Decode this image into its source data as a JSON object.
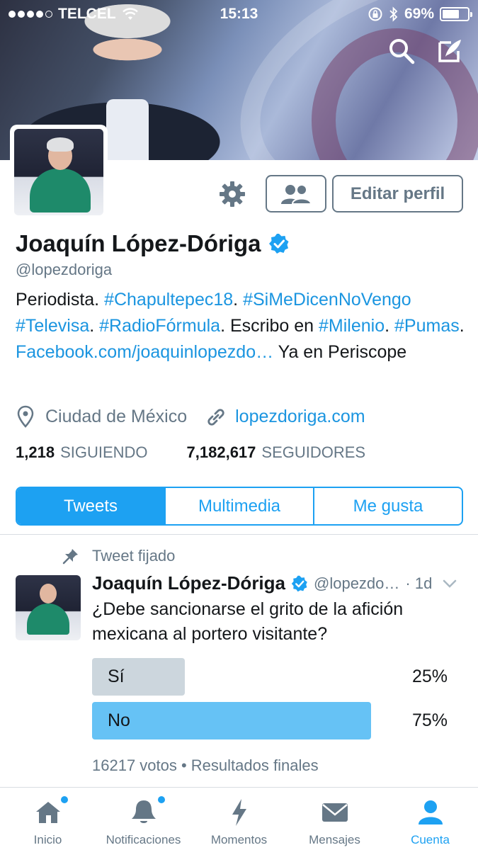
{
  "status_bar": {
    "carrier": "TELCEL",
    "time": "15:13",
    "battery": "69%",
    "battery_level": 0.69,
    "signal_bars": 4
  },
  "header": {
    "icons": [
      "search-icon",
      "compose-icon"
    ]
  },
  "profile": {
    "name": "Joaquín López-Dóriga",
    "handle": "@lopezdoriga",
    "verified": true,
    "bio": [
      {
        "text": "Periodista. ",
        "link": false
      },
      {
        "text": "#Chapultepec18",
        "link": true
      },
      {
        "text": ". ",
        "link": false
      },
      {
        "text": "#SiMeDicenNoVengo",
        "link": true
      },
      {
        "text": " ",
        "link": false
      },
      {
        "text": "#Televisa",
        "link": true
      },
      {
        "text": ". ",
        "link": false
      },
      {
        "text": "#RadioFórmula",
        "link": true
      },
      {
        "text": ". Escribo en ",
        "link": false
      },
      {
        "text": "#Milenio",
        "link": true
      },
      {
        "text": ". ",
        "link": false
      },
      {
        "text": "#Pumas",
        "link": true
      },
      {
        "text": ". ",
        "link": false
      },
      {
        "text": "Facebook.com/joaquinlopezdo…",
        "link": true
      },
      {
        "text": " Ya en Periscope",
        "link": false
      }
    ],
    "location": "Ciudad de México",
    "website": "lopezdoriga.com",
    "following_count": "1,218",
    "following_label": "SIGUIENDO",
    "followers_count": "7,182,617",
    "followers_label": "SEGUIDORES"
  },
  "actions": {
    "edit_profile": "Editar perfil"
  },
  "tabs": [
    {
      "label": "Tweets",
      "active": true
    },
    {
      "label": "Multimedia",
      "active": false
    },
    {
      "label": "Me gusta",
      "active": false
    }
  ],
  "tweet": {
    "pinned_label": "Tweet fijado",
    "author_name": "Joaquín López-Dóriga",
    "author_handle": "@lopezdo…",
    "time": "· 1d",
    "text": "¿Debe sancionarse el grito de la afición mexicana al portero visitante?",
    "poll": {
      "options": [
        {
          "label": "Sí",
          "percent": "25%",
          "value": 25,
          "color": "#ccd6dd"
        },
        {
          "label": "No",
          "percent": "75%",
          "value": 75,
          "color": "#66c2f5"
        }
      ],
      "meta": "16217 votos • Resultados finales"
    }
  },
  "bottom_nav": [
    {
      "label": "Inicio",
      "icon": "home-icon",
      "badge": true,
      "active": false
    },
    {
      "label": "Notificaciones",
      "icon": "bell-icon",
      "badge": true,
      "active": false
    },
    {
      "label": "Momentos",
      "icon": "lightning-icon",
      "badge": false,
      "active": false
    },
    {
      "label": "Mensajes",
      "icon": "envelope-icon",
      "badge": false,
      "active": false
    },
    {
      "label": "Cuenta",
      "icon": "person-icon",
      "badge": false,
      "active": true
    }
  ],
  "colors": {
    "accent": "#1da1f2",
    "link": "#1b95e0",
    "muted": "#657786",
    "text": "#14171a"
  }
}
